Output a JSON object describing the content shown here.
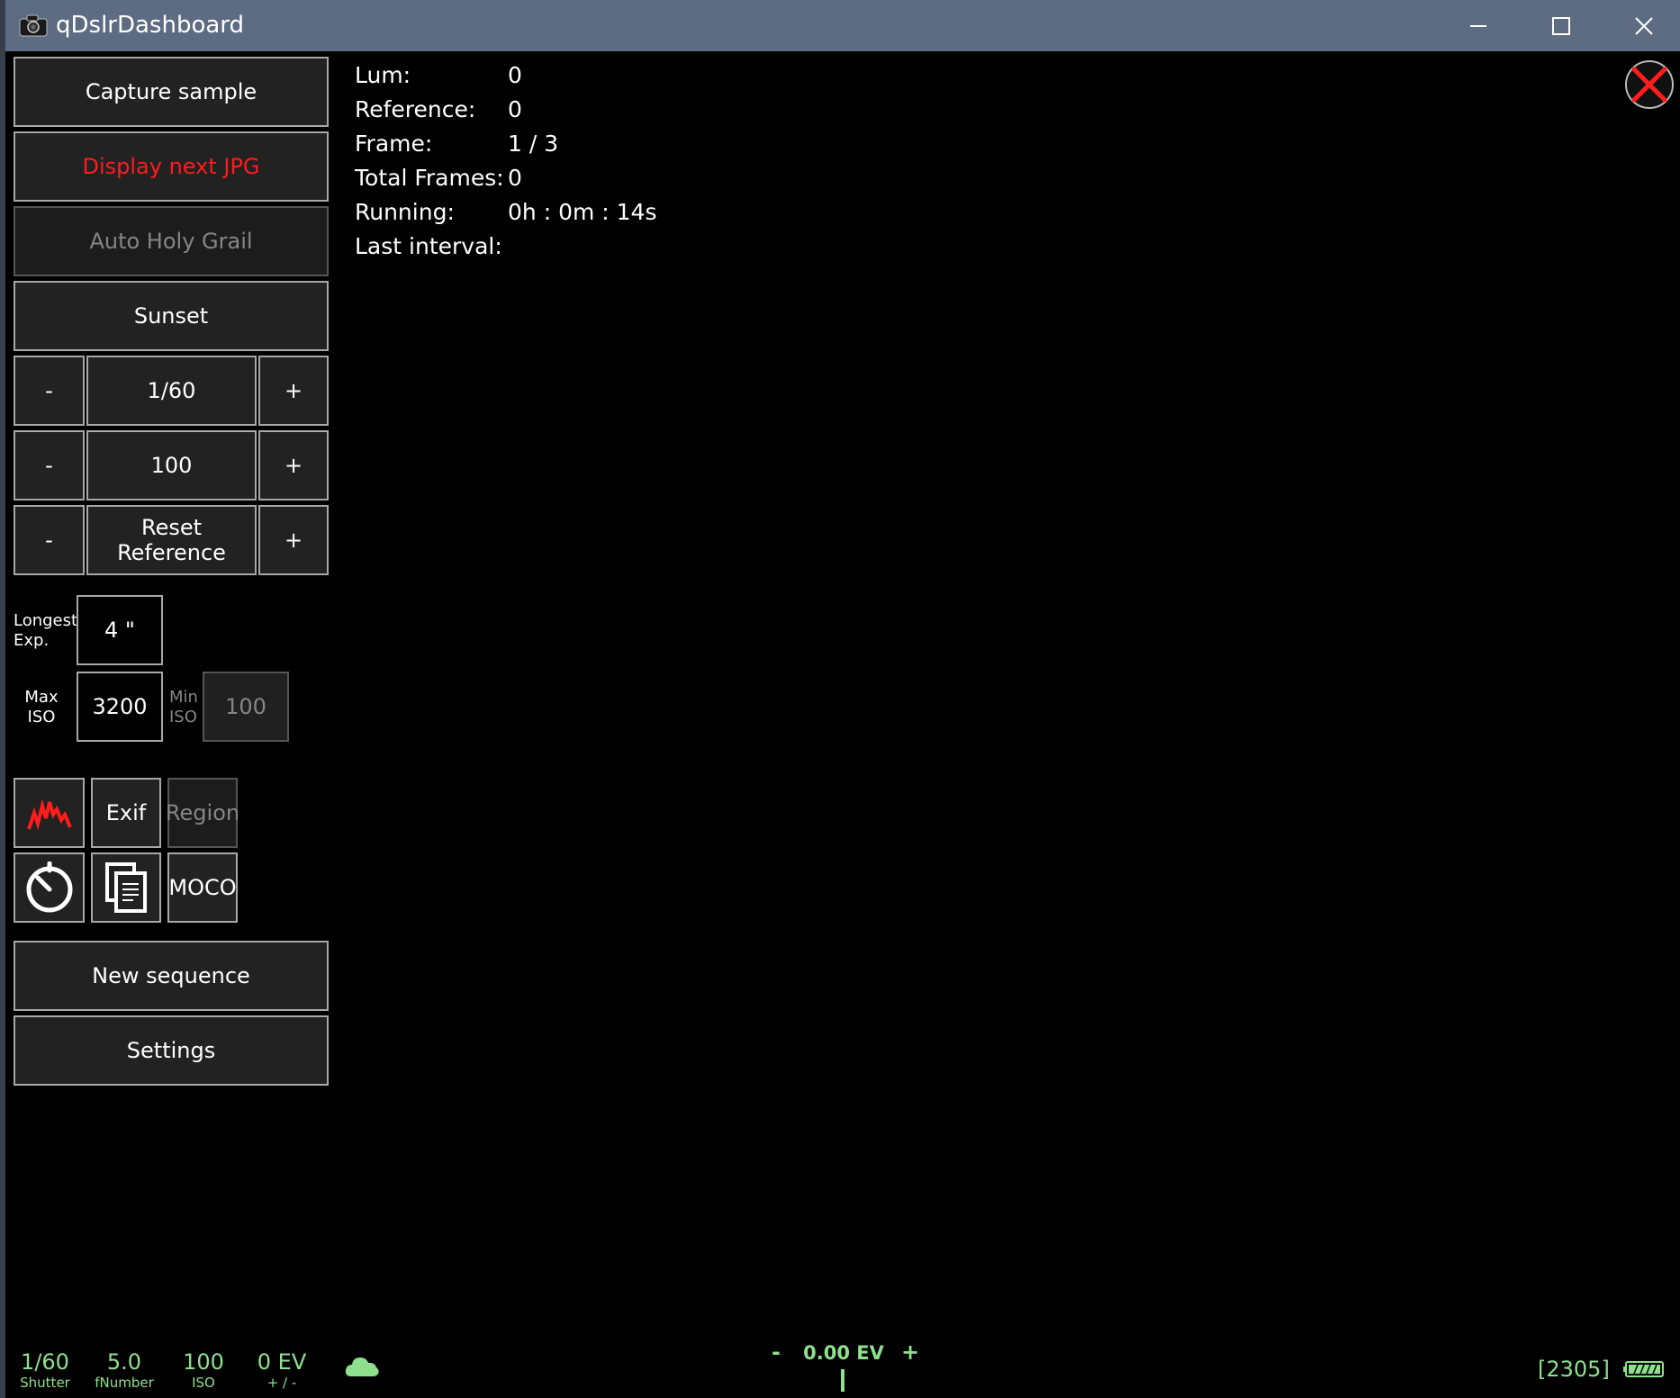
{
  "window": {
    "title": "qDslrDashboard"
  },
  "sidebar": {
    "capture_sample": "Capture sample",
    "display_next_jpg": "Display next JPG",
    "auto_holy_grail": "Auto Holy Grail",
    "sunset": "Sunset",
    "shutter_row": {
      "minus": "-",
      "value": "1/60",
      "plus": "+"
    },
    "iso_row": {
      "minus": "-",
      "value": "100",
      "plus": "+"
    },
    "reference_row": {
      "minus": "-",
      "value_line1": "Reset",
      "value_line2": "Reference",
      "plus": "+"
    },
    "longest_exp": {
      "label_line1": "Longest",
      "label_line2": "Exp.",
      "value": "4 \""
    },
    "max_iso": {
      "label_line1": "Max",
      "label_line2": "ISO",
      "value": "3200"
    },
    "min_iso": {
      "label_line1": "Min",
      "label_line2": "ISO",
      "value": "100"
    },
    "tools": {
      "histogram_icon": "histogram-icon",
      "exif": "Exif",
      "region": "Region",
      "timer_icon": "timer-icon",
      "copy_icon": "copy-icon",
      "moco": "MOCO"
    },
    "new_sequence": "New sequence",
    "settings": "Settings"
  },
  "info": {
    "rows": [
      {
        "label": "Lum:",
        "value": "0"
      },
      {
        "label": "Reference:",
        "value": "0"
      },
      {
        "label": "Frame:",
        "value": "1 / 3"
      },
      {
        "label": "Total Frames:",
        "value": "0"
      },
      {
        "label": "Running:",
        "value": "0h : 0m : 14s"
      },
      {
        "label": "Last interval:",
        "value": ""
      }
    ]
  },
  "status_bar": {
    "shutter": {
      "value": "1/60",
      "label": "Shutter"
    },
    "fnumber": {
      "value": "5.0",
      "label": "fNumber"
    },
    "iso": {
      "value": "100",
      "label": "ISO"
    },
    "ev": {
      "value": "0 EV",
      "label": "+ / -"
    },
    "ev_comp": {
      "minus": "-",
      "value": "0.00 EV",
      "plus": "+"
    },
    "counter": "[2305]"
  },
  "colors": {
    "status_green": "#8ee08e",
    "accent_red": "#ff1c1c",
    "titlebar": "#5d6c83"
  }
}
